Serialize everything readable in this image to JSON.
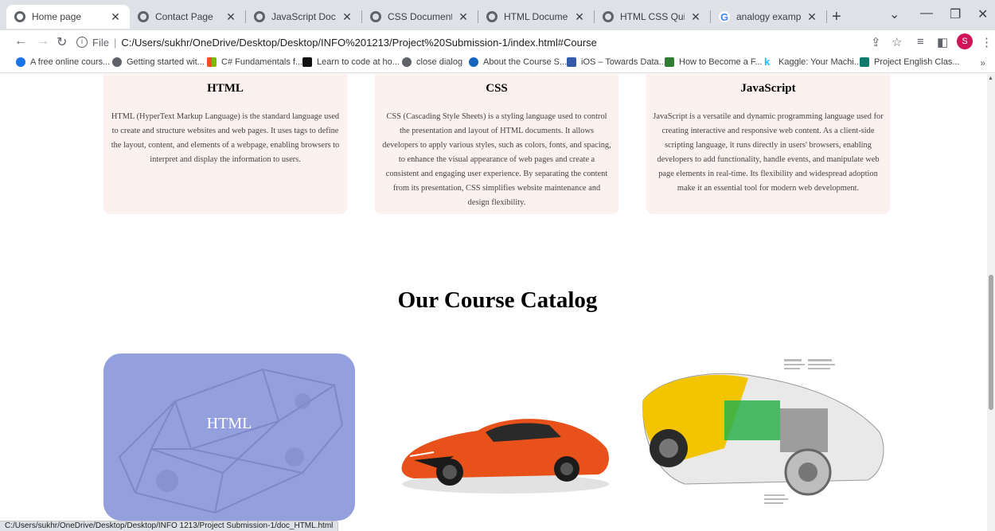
{
  "browser": {
    "tabs": [
      {
        "title": "Home page",
        "active": true
      },
      {
        "title": "Contact Page"
      },
      {
        "title": "JavaScript Documenta"
      },
      {
        "title": "CSS Documentation"
      },
      {
        "title": "HTML Documentation"
      },
      {
        "title": "HTML CSS Quiz"
      },
      {
        "title": "analogy examples - G"
      }
    ],
    "address": {
      "scheme": "File",
      "url": "C:/Users/sukhr/OneDrive/Desktop/Desktop/INFO%201213/Project%20Submission-1/index.html#Course"
    },
    "profile_initial": "S",
    "bookmarks": [
      "A free online cours...",
      "Getting started wit...",
      "C# Fundamentals f...",
      "Learn to code at ho...",
      "close dialog",
      "About the Course S...",
      "iOS – Towards Data...",
      "How to Become a F...",
      "Kaggle: Your Machi...",
      "Project English Clas..."
    ],
    "status_url": "C:/Users/sukhr/OneDrive/Desktop/Desktop/INFO 1213/Project Submission-1/doc_HTML.html"
  },
  "page": {
    "cards": [
      {
        "title": "HTML",
        "text": "HTML (HyperText Markup Language) is the standard language used to create and structure websites and web pages. It uses tags to define the layout, content, and elements of a webpage, enabling browsers to interpret and display the information to users."
      },
      {
        "title": "CSS",
        "text": "CSS (Cascading Style Sheets) is a styling language used to control the presentation and layout of HTML documents. It allows developers to apply various styles, such as colors, fonts, and spacing, to enhance the visual appearance of web pages and create a consistent and engaging user experience. By separating the content from its presentation, CSS simplifies website maintenance and design flexibility."
      },
      {
        "title": "JavaScript",
        "text": "JavaScript is a versatile and dynamic programming language used for creating interactive and responsive web content. As a client-side scripting language, it runs directly in users' browsers, enabling developers to add functionality, handle events, and manipulate web page elements in real-time. Its flexibility and widespread adoption make it an essential tool for modern web development."
      }
    ],
    "catalog_title": "Our Course Catalog",
    "course_html_label": "HTML"
  },
  "colors": {
    "card_bg": "#fdf1ef",
    "html_overlay": "#949fde",
    "profile": "#d0145a"
  }
}
